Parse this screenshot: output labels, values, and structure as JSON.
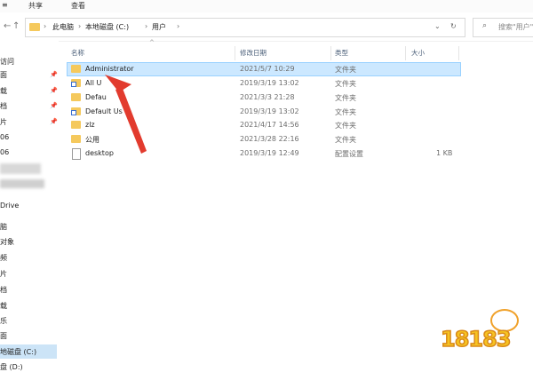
{
  "ribbon": {
    "items": [
      "≡",
      "共享",
      "查看"
    ]
  },
  "address": {
    "crumbs": [
      "此电脑",
      "本地磁盘 (C:)",
      "用户"
    ],
    "search_placeholder": "搜索\"用户\"中"
  },
  "sidebar": {
    "items": [
      "访问",
      "面",
      "载",
      "档",
      "片",
      "06",
      "06",
      "Drive",
      "脑",
      "对象",
      "频",
      "片",
      "档",
      "载",
      "乐",
      "面",
      "地磁盘 (C:)",
      "盘 (D:)"
    ]
  },
  "columns": {
    "name": "名称",
    "date": "修改日期",
    "type": "类型",
    "size": "大小"
  },
  "files": [
    {
      "name": "Administrator",
      "date": "2021/5/7 10:29",
      "type": "文件夹",
      "size": "",
      "icon": "folder-icon"
    },
    {
      "name": "All U",
      "date": "2019/3/19 13:02",
      "type": "文件夹",
      "size": "",
      "icon": "folder-shortcut-icon"
    },
    {
      "name": "Defau",
      "date": "2021/3/3 21:28",
      "type": "文件夹",
      "size": "",
      "icon": "folder-icon"
    },
    {
      "name": "Default Us",
      "date": "2019/3/19 13:02",
      "type": "文件夹",
      "size": "",
      "icon": "folder-shortcut-icon"
    },
    {
      "name": "zlz",
      "date": "2021/4/17 14:56",
      "type": "文件夹",
      "size": "",
      "icon": "folder-icon"
    },
    {
      "name": "公用",
      "date": "2021/3/28 22:16",
      "type": "文件夹",
      "size": "",
      "icon": "folder-icon"
    },
    {
      "name": "desktop",
      "date": "2019/3/19 12:49",
      "type": "配置设置",
      "size": "1 KB",
      "icon": "settings-file-icon"
    }
  ],
  "watermark": "18183",
  "colors": {
    "selection": "#cce8ff",
    "arrow": "#e23b2e",
    "folder": "#f5c95d"
  }
}
